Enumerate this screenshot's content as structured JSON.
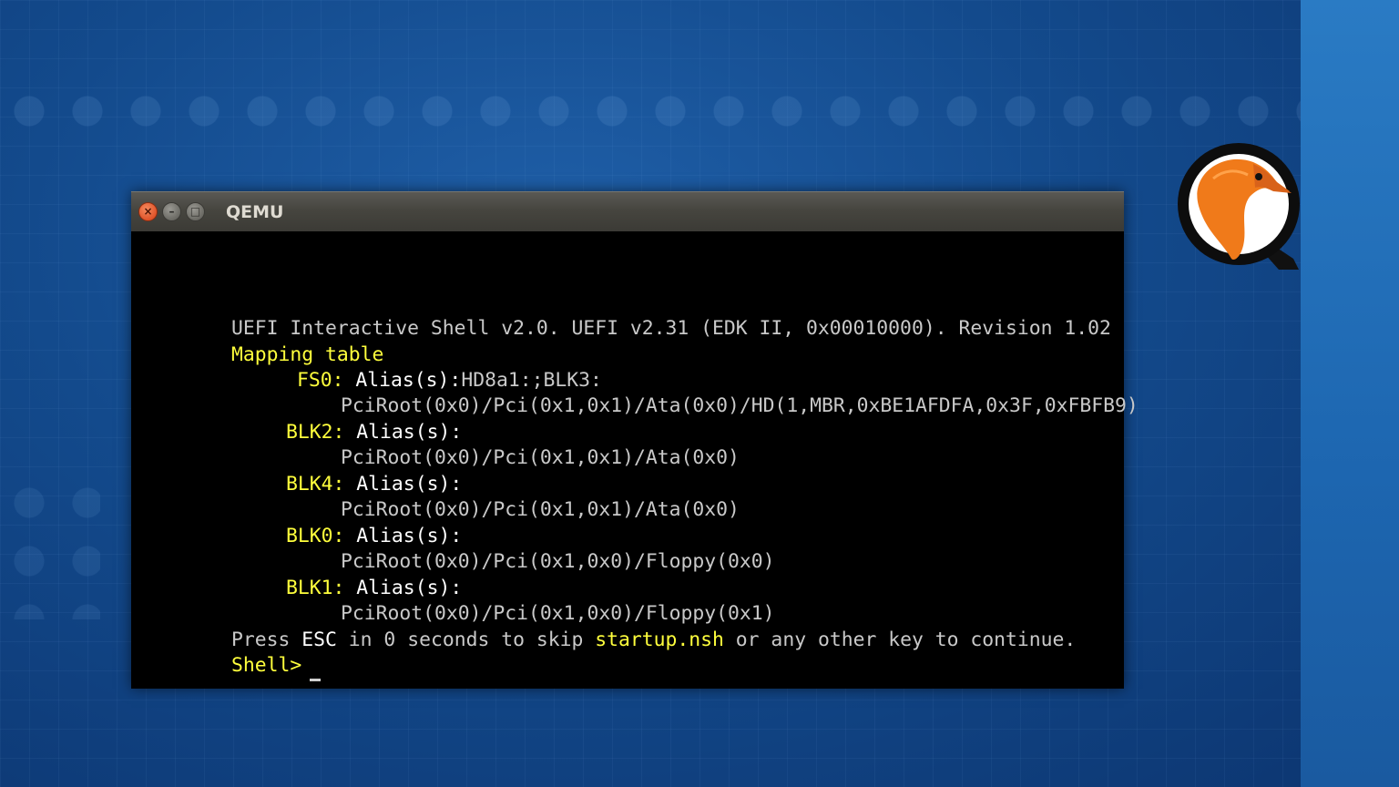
{
  "window": {
    "title": "QEMU",
    "close_glyph": "×",
    "min_glyph": "–",
    "max_glyph": "□"
  },
  "terminal": {
    "header": "UEFI Interactive Shell v2.0. UEFI v2.31 (EDK II, 0x00010000). Revision 1.02",
    "mapping_title": "Mapping table",
    "alias_label": "Alias(s):",
    "fs0": {
      "name": "FS0:",
      "alias_value": "HD8a1:;BLK3:",
      "path": "PciRoot(0x0)/Pci(0x1,0x1)/Ata(0x0)/HD(1,MBR,0xBE1AFDFA,0x3F,0xFBFB9)"
    },
    "blk2": {
      "name": "BLK2:",
      "path": "PciRoot(0x0)/Pci(0x1,0x1)/Ata(0x0)"
    },
    "blk4": {
      "name": "BLK4:",
      "path": "PciRoot(0x0)/Pci(0x1,0x1)/Ata(0x0)"
    },
    "blk0": {
      "name": "BLK0:",
      "path": "PciRoot(0x0)/Pci(0x1,0x0)/Floppy(0x0)"
    },
    "blk1": {
      "name": "BLK1:",
      "path": "PciRoot(0x0)/Pci(0x1,0x0)/Floppy(0x1)"
    },
    "startup_prefix": "Press ",
    "startup_key": "ESC",
    "startup_middle": " in 0 seconds to skip ",
    "startup_file": "startup.nsh",
    "startup_suffix": " or any other key to continue.",
    "prompt": "Shell> "
  },
  "logo": {
    "icon": "qemu-logo-icon",
    "letter": "Q"
  },
  "colors": {
    "yellow": "#ffff3c",
    "orange": "#f07a1a",
    "background": "#134a8c",
    "terminal_bg": "#000000"
  }
}
